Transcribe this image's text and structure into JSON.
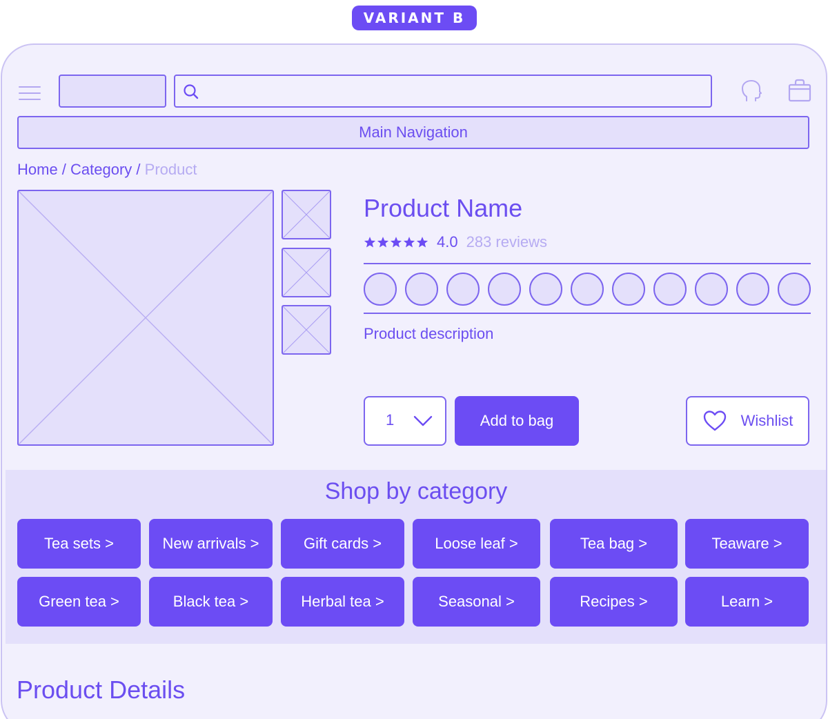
{
  "badge": {
    "label": "VARIANT B"
  },
  "header": {
    "icons": {
      "menu": "hamburger-icon",
      "search": "search-icon",
      "account": "user-icon",
      "bag": "bag-icon"
    },
    "search_value": ""
  },
  "nav": {
    "label": "Main Navigation"
  },
  "breadcrumb": {
    "home": "Home",
    "sep1": " / ",
    "category": "Category",
    "sep2": " / ",
    "current": "Product"
  },
  "product": {
    "name": "Product Name",
    "rating": "4.0",
    "rating_stars": 5,
    "reviews": "283 reviews",
    "swatch_count": 11,
    "description": "Product description",
    "quantity": "1",
    "add_to_bag": "Add to bag",
    "wishlist": "Wishlist"
  },
  "categories": {
    "title": "Shop by category",
    "items": [
      "Tea sets >",
      "New arrivals >",
      "Gift cards >",
      "Loose leaf >",
      "Tea bag >",
      "Teaware >",
      "Green tea >",
      "Black tea >",
      "Herbal tea >",
      "Seasonal >",
      "Recipes >",
      "Learn >"
    ]
  },
  "details": {
    "title": "Product Details"
  },
  "colors": {
    "primary": "#6c4cf4",
    "text": "#6b4ef0",
    "muted_text": "#b6abf2",
    "fill": "#e4e0fb",
    "background": "#f2f0fd",
    "frame_border": "#cbc3f3"
  }
}
